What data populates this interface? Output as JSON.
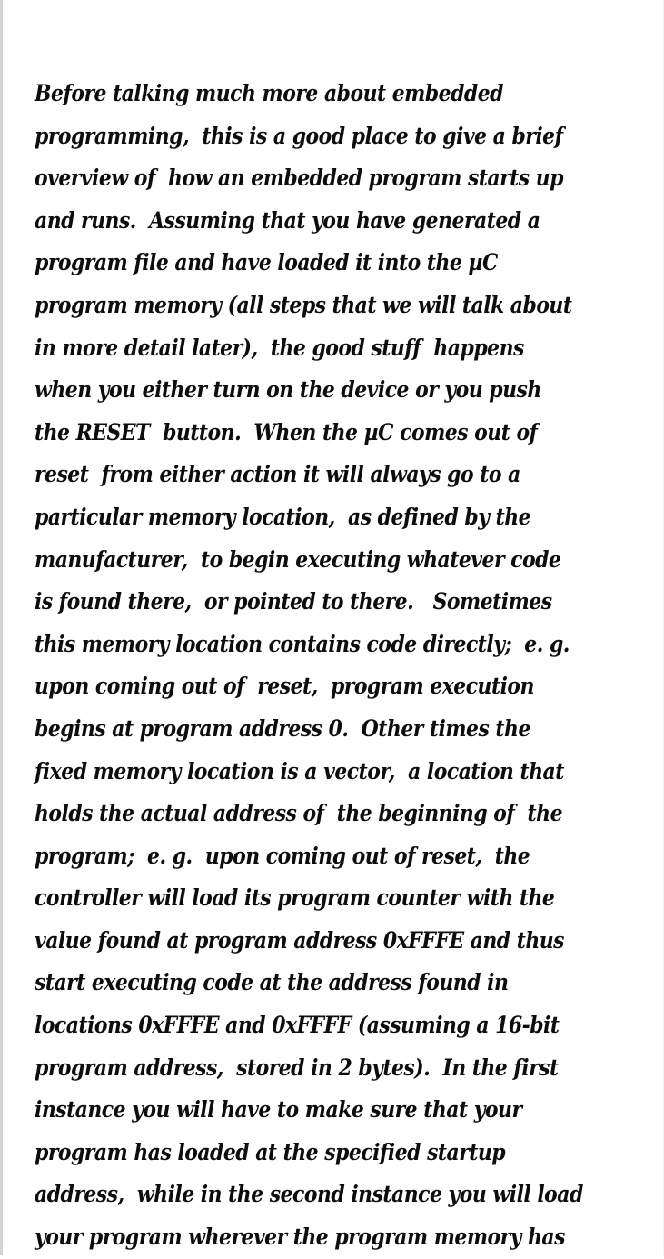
{
  "document": {
    "paragraph_lines": [
      "Before talking much more about embedded",
      "programming,  this is a good place to give a brief",
      "overview of  how an embedded program starts up",
      "and runs.  Assuming that you have generated a",
      "program file and have loaded it into the µC",
      "program memory (all steps that we will talk about",
      "in more detail later),  the good stuff  happens",
      "when you either turn on the device or you push",
      "the RESET  button.  When the µC comes out of",
      "reset  from either action it will always go to a",
      "particular memory location,  as defined by the",
      "manufacturer,  to begin executing whatever code",
      "is found there,  or pointed to there.   Sometimes",
      "this memory location contains code directly;  e. g.",
      "upon coming out of  reset,  program execution",
      "begins at program address 0.  Other times the",
      "fixed memory location is a vector,  a location that",
      "holds the actual address of  the beginning of  the",
      "program;  e. g.  upon coming out of reset,  the",
      "controller will load its program counter with the",
      "value found at program address 0xFFFE and thus",
      "start executing code at the address found in",
      "locations 0xFFFE and 0xFFFF (assuming a 16-bit",
      "program address,  stored in 2 bytes).  In the first",
      "instance you will have to make sure that your",
      "program has loaded at the specified startup",
      "address,  while in the second instance you will load",
      "your program wherever the program memory has"
    ]
  }
}
